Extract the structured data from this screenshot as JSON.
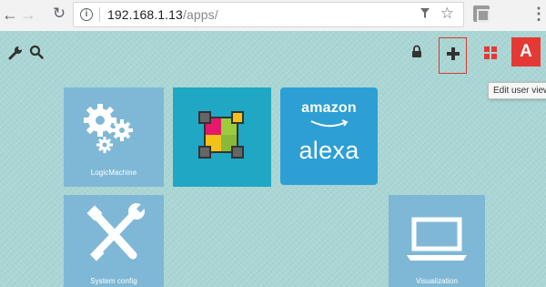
{
  "browser": {
    "url_host": "192.168.1.13",
    "url_path": "/apps/",
    "icons": [
      "back-icon",
      "forward-icon",
      "reload-icon",
      "info-icon",
      "filter-icon",
      "star-icon",
      "extension-icon",
      "menu-icon"
    ]
  },
  "toolbar": {
    "user_initial": "A",
    "tooltip": "Edit user view",
    "icons": [
      "wrench-icon",
      "search-icon",
      "lock-icon",
      "plus-icon",
      "grid-icon"
    ],
    "colors": {
      "accent": "#e53935",
      "icon": "#333333"
    }
  },
  "tiles": [
    {
      "label": "LogicMachine",
      "icon": "gears-icon",
      "color": "#7fb8d6"
    },
    {
      "label": "",
      "icon": "color-picker-icon",
      "color": "#1fa7c4"
    },
    {
      "label": "",
      "icon": "alexa-logo",
      "color": "#2d9fd4",
      "logo_top": "amazon",
      "logo_bottom": "alexa"
    },
    {
      "label": "System config",
      "icon": "tools-icon",
      "color": "#7fb8d6"
    },
    {
      "label": "Visualization",
      "icon": "laptop-icon",
      "color": "#7fb8d6"
    }
  ],
  "background_color": "#a9d6d4"
}
